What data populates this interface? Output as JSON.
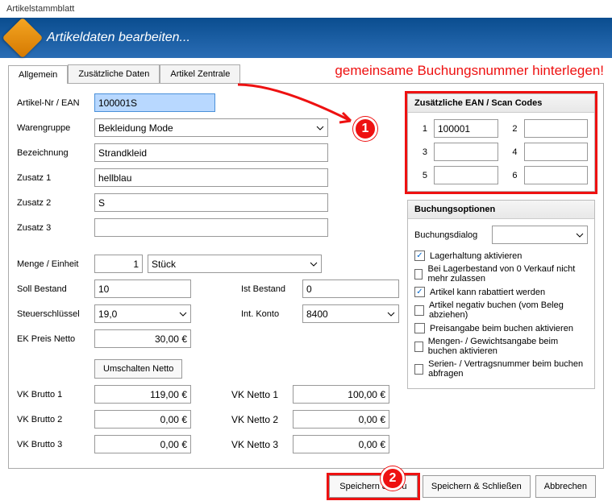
{
  "window": {
    "title": "Artikelstammblatt",
    "heading": "Artikeldaten bearbeiten..."
  },
  "tabs": {
    "t1": "Allgemein",
    "t2": "Zusätzliche Daten",
    "t3": "Artikel Zentrale"
  },
  "annotation": {
    "text": "gemeinsame Buchungsnummer hinterlegen!",
    "c1": "1",
    "c2": "2"
  },
  "labels": {
    "artikelnr": "Artikel-Nr / EAN",
    "warengruppe": "Warengruppe",
    "bezeichnung": "Bezeichnung",
    "zusatz1": "Zusatz 1",
    "zusatz2": "Zusatz 2",
    "zusatz3": "Zusatz 3",
    "menge": "Menge / Einheit",
    "soll": "Soll Bestand",
    "ist": "Ist Bestand",
    "steuer": "Steuerschlüssel",
    "konto": "Int. Konto",
    "ek": "EK Preis Netto",
    "umschalten": "Umschalten Netto",
    "vkb1": "VK Brutto 1",
    "vkn1": "VK Netto 1",
    "vkb2": "VK Brutto 2",
    "vkn2": "VK Netto 2",
    "vkb3": "VK Brutto 3",
    "vkn3": "VK Netto 3"
  },
  "values": {
    "artikelnr": "100001S",
    "warengruppe": "Bekleidung Mode",
    "bezeichnung": "Strandkleid",
    "zusatz1": "hellblau",
    "zusatz2": "S",
    "zusatz3": "",
    "menge": "1",
    "einheit": "Stück",
    "soll": "10",
    "ist": "0",
    "steuer": "19,0",
    "konto": "8400",
    "ek": "30,00 €",
    "vkb1": "119,00 €",
    "vkn1": "100,00 €",
    "vkb2": "0,00 €",
    "vkn2": "0,00 €",
    "vkb3": "0,00 €",
    "vkn3": "0,00 €"
  },
  "ean": {
    "title": "Zusätzliche EAN / Scan Codes",
    "n1": "1",
    "n2": "2",
    "n3": "3",
    "n4": "4",
    "n5": "5",
    "n6": "6",
    "v1": "100001",
    "v2": "",
    "v3": "",
    "v4": "",
    "v5": "",
    "v6": ""
  },
  "options": {
    "title": "Buchungsoptionen",
    "dialogLabel": "Buchungsdialog",
    "dialogValue": "",
    "o1": "Lagerhaltung aktivieren",
    "o2": "Bei Lagerbestand von 0 Verkauf nicht mehr zulassen",
    "o3": "Artikel kann rabattiert werden",
    "o4": "Artikel negativ buchen (vom Beleg abziehen)",
    "o5": "Preisangabe beim buchen aktivieren",
    "o6": "Mengen- / Gewichtsangabe beim buchen aktivieren",
    "o7": "Serien- / Vertragsnummer beim buchen abfragen",
    "c1": true,
    "c2": false,
    "c3": true,
    "c4": false,
    "c5": false,
    "c6": false,
    "c7": false
  },
  "footer": {
    "saveNew": "Speichern & Neu",
    "saveClose": "Speichern & Schließen",
    "cancel": "Abbrechen"
  }
}
